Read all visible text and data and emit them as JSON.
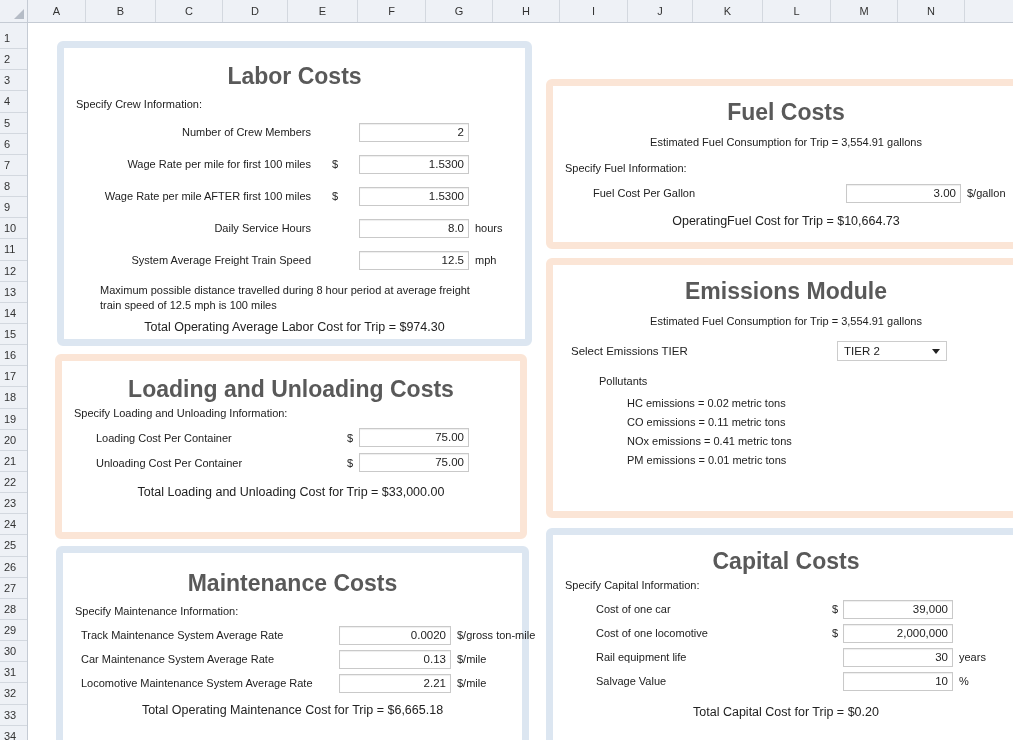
{
  "column_headers": [
    "A",
    "B",
    "C",
    "D",
    "E",
    "F",
    "G",
    "H",
    "I",
    "J",
    "K",
    "L",
    "M",
    "N"
  ],
  "row_numbers": [
    "1",
    "2",
    "3",
    "4",
    "5",
    "6",
    "7",
    "8",
    "9",
    "10",
    "11",
    "12",
    "13",
    "14",
    "15",
    "16",
    "17",
    "18",
    "19",
    "20",
    "21",
    "22",
    "23",
    "24",
    "25",
    "26",
    "27",
    "28",
    "29",
    "30",
    "31",
    "32",
    "33",
    "34"
  ],
  "panels": [
    {
      "title": "Labor Costs",
      "color": "#dce6f1",
      "items": [
        {
          "kind": "heading",
          "text": "Specify Crew Information:"
        },
        {
          "kind": "field",
          "label": "Number of Crew Members",
          "value": "2"
        },
        {
          "kind": "field",
          "label": "Wage Rate per mile for first 100 miles",
          "prefix": "$",
          "value": "1.5300"
        },
        {
          "kind": "field",
          "label": "Wage Rate per mile AFTER first 100 miles",
          "prefix": "$",
          "value": "1.5300"
        },
        {
          "kind": "field",
          "label": "Daily Service Hours",
          "value": "8.0",
          "unit": "hours"
        },
        {
          "kind": "field",
          "label": "System Average Freight Train Speed",
          "value": "12.5",
          "unit": "mph"
        },
        {
          "kind": "note",
          "text": "Maximum possible distance travelled during 8 hour period at average freight train speed of 12.5 mph is 100 miles"
        },
        {
          "kind": "total",
          "text": "Total Operating Average Labor Cost for Trip = $974.30"
        }
      ]
    },
    {
      "title": "Loading and Unloading Costs",
      "color": "#fbe5d6",
      "items": [
        {
          "kind": "heading",
          "text": "Specify Loading and Unloading Information:"
        },
        {
          "kind": "field",
          "label": "Loading Cost Per Container",
          "prefix": "$",
          "value": "75.00"
        },
        {
          "kind": "field",
          "label": "Unloading Cost Per Container",
          "prefix": "$",
          "value": "75.00"
        },
        {
          "kind": "total",
          "text": "Total Loading and Unloading Cost for Trip = $33,000.00"
        }
      ]
    },
    {
      "title": "Maintenance Costs",
      "color": "#dce6f1",
      "items": [
        {
          "kind": "heading",
          "text": "Specify Maintenance Information:"
        },
        {
          "kind": "field",
          "label": "Track Maintenance System Average Rate",
          "value": "0.0020",
          "unit": "$/gross ton-mile"
        },
        {
          "kind": "field",
          "label": "Car Maintenance System Average Rate",
          "value": "0.13",
          "unit": "$/mile"
        },
        {
          "kind": "field",
          "label": "Locomotive Maintenance System Average Rate",
          "value": "2.21",
          "unit": "$/mile"
        },
        {
          "kind": "total",
          "text": "Total Operating Maintenance Cost for Trip = $6,665.18"
        }
      ]
    },
    {
      "title": "Fuel Costs",
      "color": "#fbe5d6",
      "items": [
        {
          "kind": "info",
          "text": "Estimated Fuel Consumption for Trip = 3,554.91 gallons"
        },
        {
          "kind": "heading",
          "text": "Specify Fuel Information:"
        },
        {
          "kind": "field",
          "label": "Fuel Cost Per Gallon",
          "value": "3.00",
          "unit": "$/gallon"
        },
        {
          "kind": "total",
          "text": "OperatingFuel Cost for Trip = $10,664.73"
        }
      ]
    },
    {
      "title": "Emissions Module",
      "color": "#fbe5d6",
      "items": [
        {
          "kind": "info",
          "text": "Estimated Fuel Consumption for Trip = 3,554.91 gallons"
        },
        {
          "kind": "dropdown",
          "label": "Select Emissions TIER",
          "value": "TIER 2"
        },
        {
          "kind": "subheading",
          "text": "Pollutants"
        },
        {
          "kind": "line",
          "text": "HC emissions = 0.02 metric tons"
        },
        {
          "kind": "line",
          "text": "CO emissions = 0.11 metric tons"
        },
        {
          "kind": "line",
          "text": "NOx emissions = 0.41 metric tons"
        },
        {
          "kind": "line",
          "text": "PM emissions = 0.01 metric tons"
        }
      ]
    },
    {
      "title": "Capital Costs",
      "color": "#dce6f1",
      "items": [
        {
          "kind": "heading",
          "text": "Specify Capital Information:"
        },
        {
          "kind": "field",
          "label": "Cost of one car",
          "prefix": "$",
          "value": "39,000"
        },
        {
          "kind": "field",
          "label": "Cost of one locomotive",
          "prefix": "$",
          "value": "2,000,000"
        },
        {
          "kind": "field",
          "label": "Rail equipment life",
          "value": "30",
          "unit": "years"
        },
        {
          "kind": "field",
          "label": "Salvage Value",
          "value": "10",
          "unit": "%"
        },
        {
          "kind": "total",
          "text": "Total Capital Cost for Trip = $0.20"
        }
      ]
    }
  ]
}
